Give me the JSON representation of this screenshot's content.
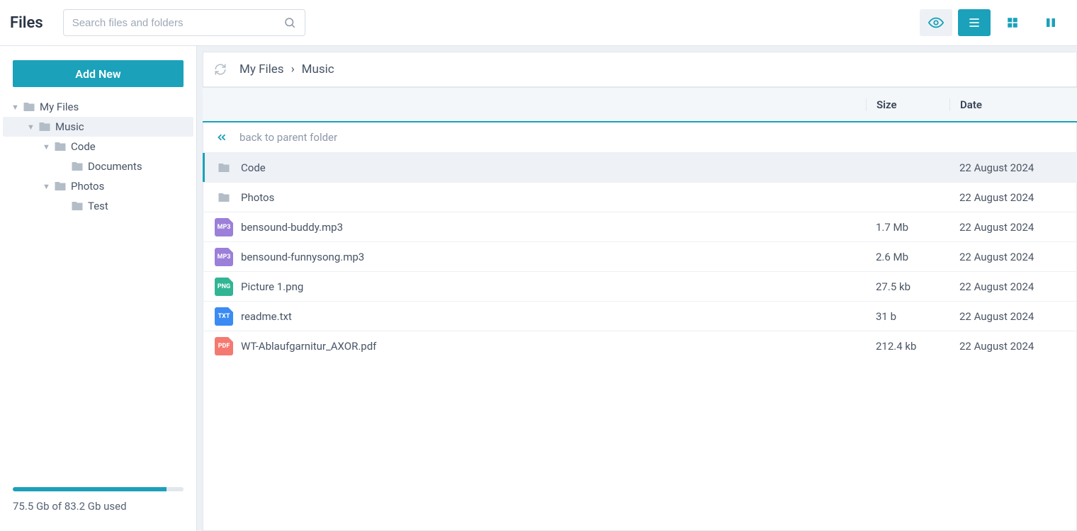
{
  "app": {
    "title": "Files"
  },
  "search": {
    "placeholder": "Search files and folders"
  },
  "sidebar": {
    "add_label": "Add New",
    "tree": [
      {
        "label": "My Files",
        "indent": 0,
        "expanded": true,
        "has_children": true,
        "selected": false
      },
      {
        "label": "Music",
        "indent": 1,
        "expanded": true,
        "has_children": true,
        "selected": true
      },
      {
        "label": "Code",
        "indent": 2,
        "expanded": true,
        "has_children": true,
        "selected": false
      },
      {
        "label": "Documents",
        "indent": 3,
        "expanded": false,
        "has_children": false,
        "selected": false
      },
      {
        "label": "Photos",
        "indent": 2,
        "expanded": true,
        "has_children": true,
        "selected": false
      },
      {
        "label": "Test",
        "indent": 3,
        "expanded": false,
        "has_children": false,
        "selected": false
      }
    ],
    "storage": {
      "text": "75.5 Gb of 83.2 Gb used",
      "fill_percent": 90
    }
  },
  "breadcrumbs": [
    "My Files",
    "Music"
  ],
  "columns": {
    "size": "Size",
    "date": "Date"
  },
  "back_label": "back to parent folder",
  "rows": [
    {
      "type": "folder",
      "name": "Code",
      "size": "",
      "date": "22 August 2024",
      "selected": true
    },
    {
      "type": "folder",
      "name": "Photos",
      "size": "",
      "date": "22 August 2024",
      "selected": false
    },
    {
      "type": "mp3",
      "badge": "MP3",
      "name": "bensound-buddy.mp3",
      "size": "1.7 Mb",
      "date": "22 August 2024",
      "selected": false
    },
    {
      "type": "mp3",
      "badge": "MP3",
      "name": "bensound-funnysong.mp3",
      "size": "2.6 Mb",
      "date": "22 August 2024",
      "selected": false
    },
    {
      "type": "png",
      "badge": "PNG",
      "name": "Picture 1.png",
      "size": "27.5 kb",
      "date": "22 August 2024",
      "selected": false
    },
    {
      "type": "txt",
      "badge": "TXT",
      "name": "readme.txt",
      "size": "31 b",
      "date": "22 August 2024",
      "selected": false
    },
    {
      "type": "pdf",
      "badge": "PDF",
      "name": "WT-Ablaufgarnitur_AXOR.pdf",
      "size": "212.4 kb",
      "date": "22 August 2024",
      "selected": false
    }
  ]
}
